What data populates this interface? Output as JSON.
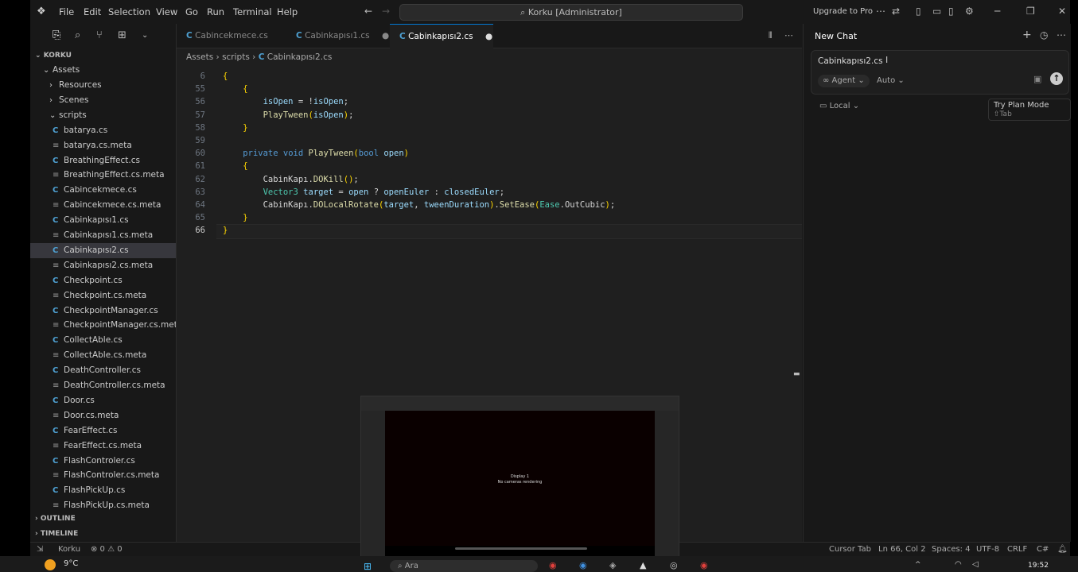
{
  "titlebar": {
    "menu": [
      "File",
      "Edit",
      "Selection",
      "View",
      "Go",
      "Run",
      "Terminal",
      "Help"
    ],
    "search": "Korku [Administrator]",
    "upgrade": "Upgrade to Pro"
  },
  "sidebar": {
    "root": "KORKU",
    "assets_folder": "Assets",
    "items": [
      {
        "label": "Resources",
        "type": "folder"
      },
      {
        "label": "Scenes",
        "type": "folder"
      },
      {
        "label": "scripts",
        "type": "folder-open"
      },
      {
        "label": "batarya.cs",
        "type": "cs"
      },
      {
        "label": "batarya.cs.meta",
        "type": "meta"
      },
      {
        "label": "BreathingEffect.cs",
        "type": "cs"
      },
      {
        "label": "BreathingEffect.cs.meta",
        "type": "meta"
      },
      {
        "label": "Cabincekmece.cs",
        "type": "cs"
      },
      {
        "label": "Cabincekmece.cs.meta",
        "type": "meta"
      },
      {
        "label": "Cabinkapısı1.cs",
        "type": "cs"
      },
      {
        "label": "Cabinkapısı1.cs.meta",
        "type": "meta"
      },
      {
        "label": "Cabinkapısı2.cs",
        "type": "cs"
      },
      {
        "label": "Cabinkapısı2.cs.meta",
        "type": "meta"
      },
      {
        "label": "Checkpoint.cs",
        "type": "cs"
      },
      {
        "label": "Checkpoint.cs.meta",
        "type": "meta"
      },
      {
        "label": "CheckpointManager.cs",
        "type": "cs"
      },
      {
        "label": "CheckpointManager.cs.meta",
        "type": "meta"
      },
      {
        "label": "CollectAble.cs",
        "type": "cs"
      },
      {
        "label": "CollectAble.cs.meta",
        "type": "meta"
      },
      {
        "label": "DeathController.cs",
        "type": "cs"
      },
      {
        "label": "DeathController.cs.meta",
        "type": "meta"
      },
      {
        "label": "Door.cs",
        "type": "cs"
      },
      {
        "label": "Door.cs.meta",
        "type": "meta"
      },
      {
        "label": "FearEffect.cs",
        "type": "cs"
      },
      {
        "label": "FearEffect.cs.meta",
        "type": "meta"
      },
      {
        "label": "FlashControler.cs",
        "type": "cs"
      },
      {
        "label": "FlashControler.cs.meta",
        "type": "meta"
      },
      {
        "label": "FlashPickUp.cs",
        "type": "cs"
      },
      {
        "label": "FlashPickUp.cs.meta",
        "type": "meta"
      }
    ],
    "outline": "OUTLINE",
    "timeline": "TIMELINE"
  },
  "editor": {
    "tabs": [
      {
        "label": "Cabincekmece.cs"
      },
      {
        "label": "Cabinkapısı1.cs"
      },
      {
        "label": "Cabinkapısı2.cs"
      }
    ],
    "breadcrumb": [
      "Assets",
      "scripts",
      "Cabinkapısı2.cs"
    ],
    "lines": [
      {
        "no": "6",
        "text": "{"
      },
      {
        "no": "55",
        "text": "    {"
      },
      {
        "no": "56",
        "text": "        isOpen = !isOpen;"
      },
      {
        "no": "57",
        "text": "        PlayTween(isOpen);"
      },
      {
        "no": "58",
        "text": "    }"
      },
      {
        "no": "59",
        "text": ""
      },
      {
        "no": "60",
        "text": "    private void PlayTween(bool open)"
      },
      {
        "no": "61",
        "text": "    {"
      },
      {
        "no": "62",
        "text": "        CabinKapı.DOKill();"
      },
      {
        "no": "63",
        "text": "        Vector3 target = open ? openEuler : closedEuler;"
      },
      {
        "no": "64",
        "text": "        CabinKapı.DOLocalRotate(target, tweenDuration).SetEase(Ease.OutCubic);"
      },
      {
        "no": "65",
        "text": "    }"
      },
      {
        "no": "66",
        "text": "}"
      }
    ]
  },
  "chat": {
    "title": "New Chat",
    "context_file": "Cabinkapısı2.cs",
    "agent": "Agent",
    "auto": "Auto",
    "local": "Local",
    "plan_mode": "Try Plan Mode",
    "plan_key": "⇧Tab"
  },
  "statusbar": {
    "project": "Korku",
    "problems": "⊗ 0 ⚠ 0",
    "cursor_tab": "Cursor Tab",
    "position": "Ln 66, Col 2",
    "spaces": "Spaces: 4",
    "encoding": "UTF-8",
    "eol": "CRLF",
    "language": "C#"
  },
  "preview": {
    "display": "Display 1",
    "message": "No cameras rendering"
  },
  "taskbar": {
    "weather": "9°C",
    "search": "Ara",
    "time": "19:52"
  }
}
